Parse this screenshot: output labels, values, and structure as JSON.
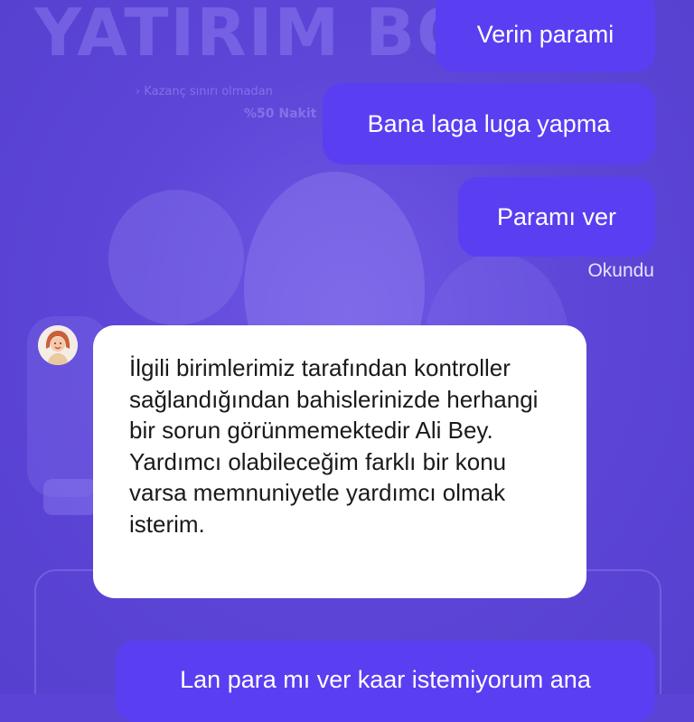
{
  "background": {
    "promo_title": "YATIRIM BO",
    "promo_subtitle_1": "› Kazanç sınırı olmadan",
    "promo_subtitle_2": "%50 Nakit"
  },
  "messages": {
    "outgoing_1": "Verin parami",
    "outgoing_2": "Bana laga luga yapma",
    "outgoing_3": "Paramı ver",
    "read_status": "Okundu",
    "incoming_1": "İlgili birimlerimiz tarafından kontroller sağlandığından bahislerinizde herhangi bir sorun görünmemektedir Ali Bey. Yardımcı olabileceğim farklı bir konu varsa memnuniyetle yardımcı olmak isterim.",
    "outgoing_4": "Lan para mı ver kaar istemiyorum ana"
  },
  "colors": {
    "background": "#5b43d6",
    "outgoing_bubble": "#5a3ef2",
    "incoming_bubble": "#ffffff"
  }
}
